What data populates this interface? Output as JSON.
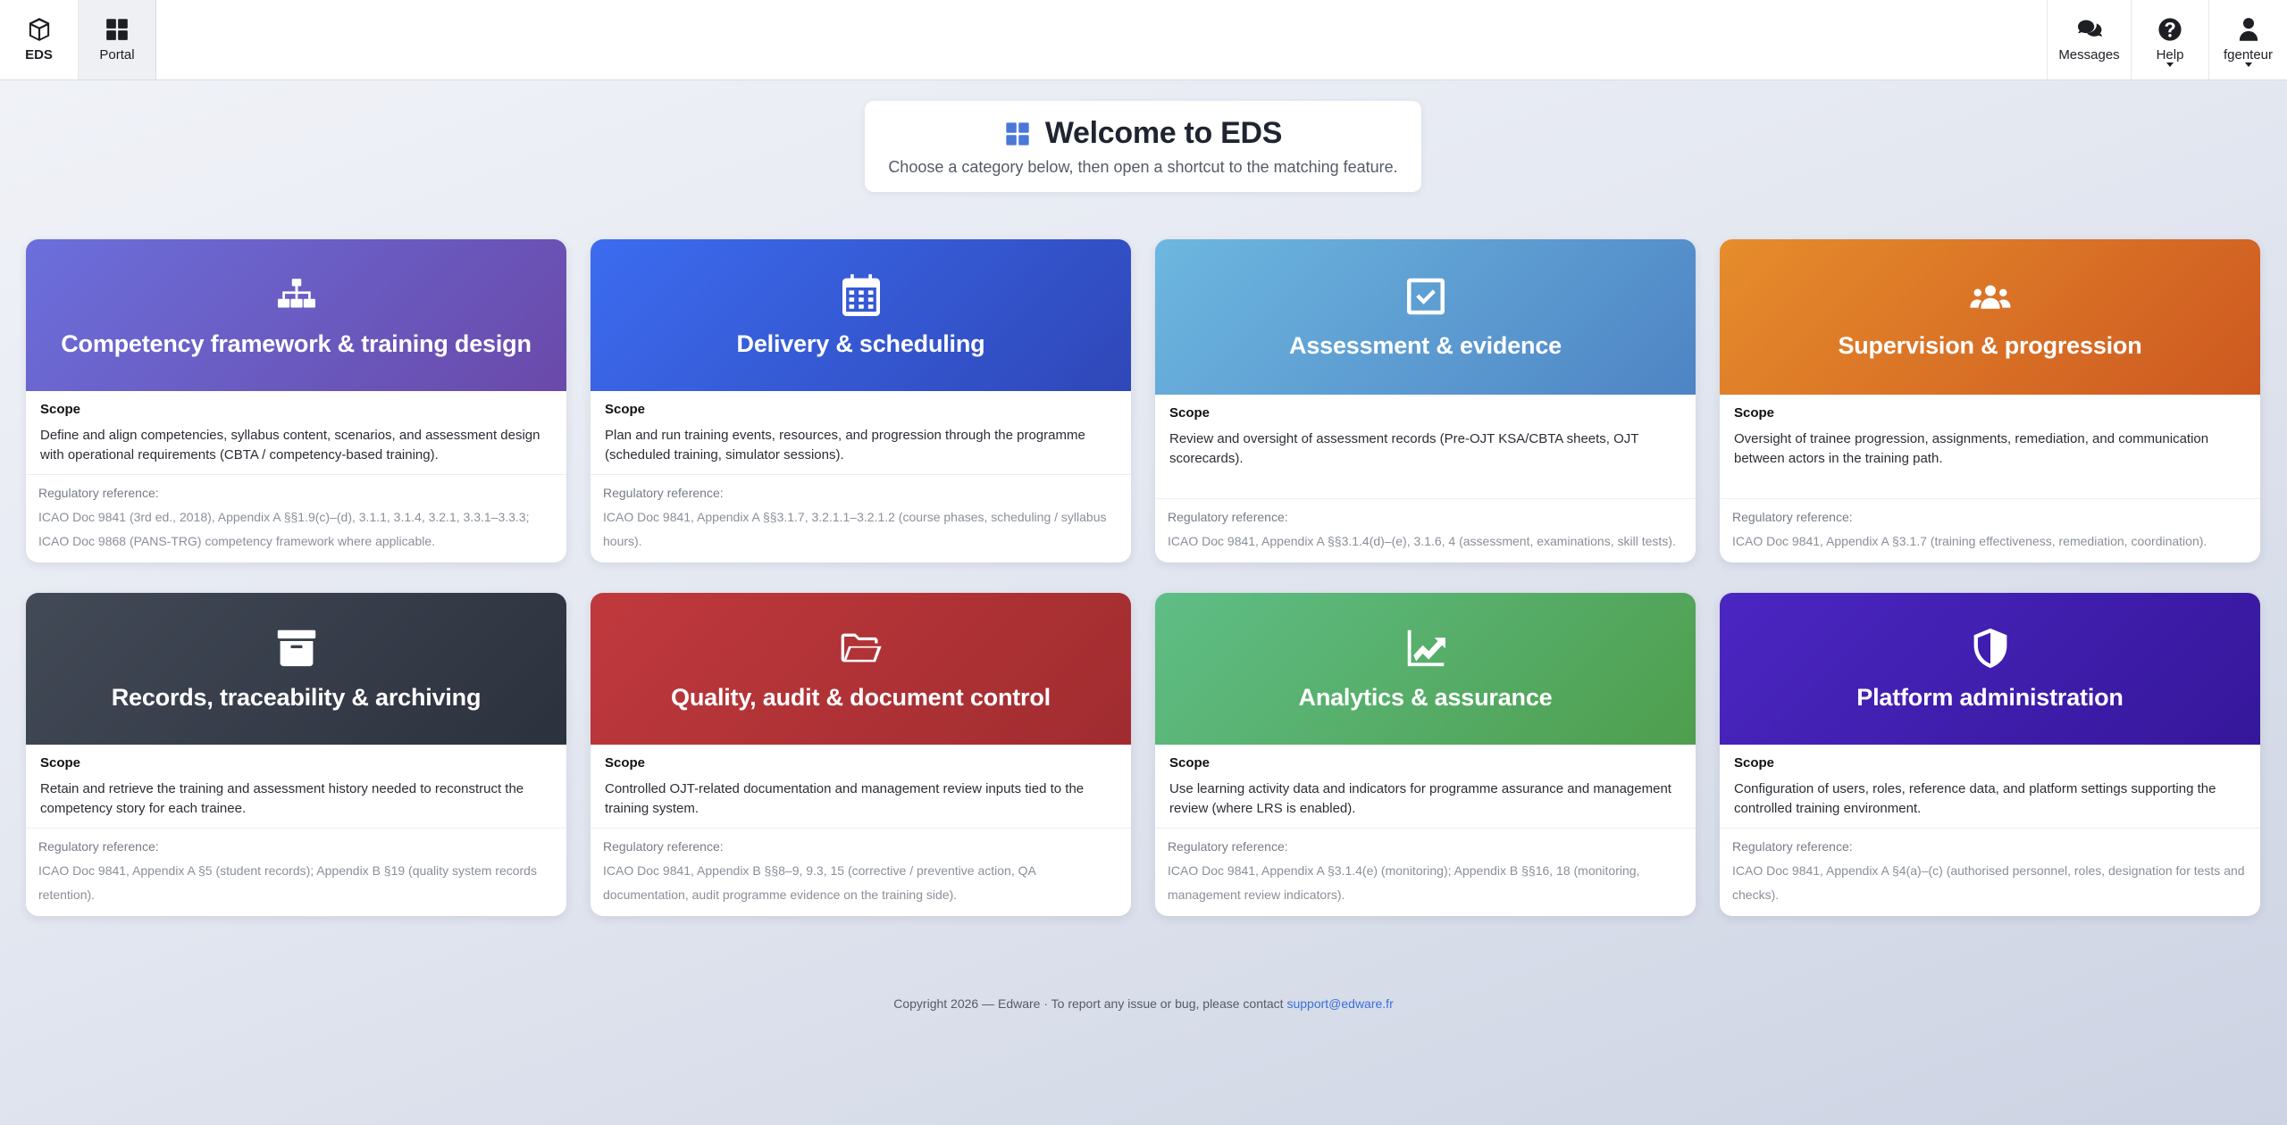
{
  "navbar": {
    "brand_label": "EDS",
    "portal_label": "Portal",
    "messages_label": "Messages",
    "help_label": "Help",
    "user_label": "fgenteur"
  },
  "welcome": {
    "title": "Welcome to EDS",
    "subtitle": "Choose a category below, then open a shortcut to the matching feature."
  },
  "labels": {
    "scope": "Scope",
    "regulatory": "Regulatory reference:"
  },
  "cards": [
    {
      "title": "Competency framework & training design",
      "icon": "sitemap-icon",
      "color": "#6a5fcf",
      "scope": "Define and align competencies, syllabus content, scenarios, and assessment design with operational requirements (CBTA / competency-based training).",
      "reference": "ICAO Doc 9841 (3rd ed., 2018), Appendix A §§1.9(c)–(d), 3.1.1, 3.1.4, 3.2.1, 3.3.1–3.3.3; ICAO Doc 9868 (PANS-TRG) competency framework where applicable."
    },
    {
      "title": "Delivery & scheduling",
      "icon": "calendar-icon",
      "color": "#3559d6",
      "scope": "Plan and run training events, resources, and progression through the programme (scheduled training, simulator sessions).",
      "reference": "ICAO Doc 9841, Appendix A §§3.1.7, 3.2.1.1–3.2.1.2 (course phases, scheduling / syllabus hours)."
    },
    {
      "title": "Assessment & evidence",
      "icon": "check-square-icon",
      "color": "#5b9cd3",
      "scope": "Review and oversight of assessment records (Pre-OJT KSA/CBTA sheets, OJT scorecards).",
      "reference": "ICAO Doc 9841, Appendix A §§3.1.4(d)–(e), 3.1.6, 4 (assessment, examinations, skill tests)."
    },
    {
      "title": "Supervision & progression",
      "icon": "users-icon",
      "color": "#da7026",
      "scope": "Oversight of trainee progression, assignments, remediation, and communication between actors in the training path.",
      "reference": "ICAO Doc 9841, Appendix A §3.1.7 (training effectiveness, remediation, coordination)."
    },
    {
      "title": "Records, traceability & archiving",
      "icon": "archive-icon",
      "color": "#373d4a",
      "scope": "Retain and retrieve the training and assessment history needed to reconstruct the competency story for each trainee.",
      "reference": "ICAO Doc 9841, Appendix A §5 (student records); Appendix B §19 (quality system records retention)."
    },
    {
      "title": "Quality, audit & document control",
      "icon": "folder-open-icon",
      "color": "#b03236",
      "scope": "Controlled OJT-related documentation and management review inputs tied to the training system.",
      "reference": "ICAO Doc 9841, Appendix B §§8–9, 9.3, 15 (corrective / preventive action, QA documentation, audit programme evidence on the training side)."
    },
    {
      "title": "Analytics & assurance",
      "icon": "chart-line-icon",
      "color": "#58ae6a",
      "scope": "Use learning activity data and indicators for programme assurance and management review (where LRS is enabled).",
      "reference": "ICAO Doc 9841, Appendix A §3.1.4(e) (monitoring); Appendix B §§16, 18 (monitoring, management review indicators)."
    },
    {
      "title": "Platform administration",
      "icon": "shield-icon",
      "color": "#401fae",
      "scope": "Configuration of users, roles, reference data, and platform settings supporting the controlled training environment.",
      "reference": "ICAO Doc 9841, Appendix A §4(a)–(c) (authorised personnel, roles, designation for tests and checks)."
    }
  ],
  "footer": {
    "text": "Copyright 2026 — Edware · To report any issue or bug, please contact ",
    "email": "support@edware.fr"
  }
}
